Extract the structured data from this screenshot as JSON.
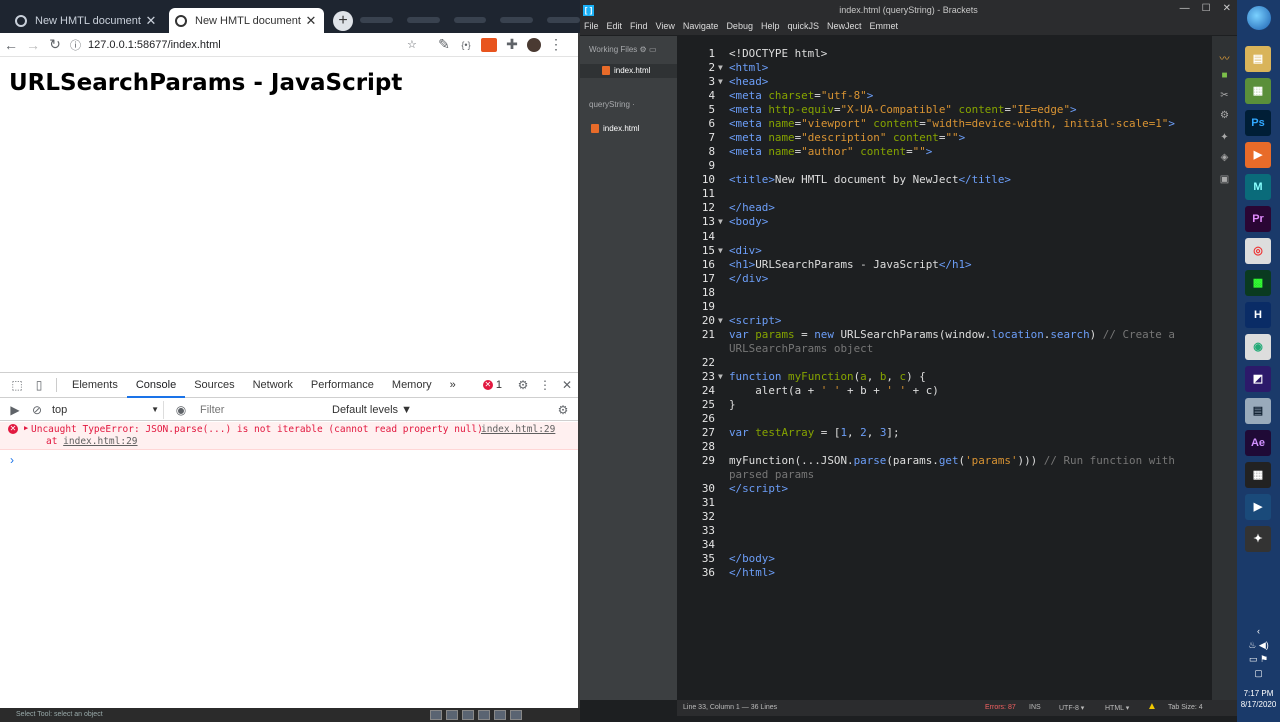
{
  "chrome": {
    "tabs": [
      {
        "title": "New HMTL document by NewJect",
        "close": "✕"
      },
      {
        "title": "New HMTL document by NewJect",
        "close": "✕"
      }
    ],
    "new_tab": "+",
    "toolbar": {
      "url": "127.0.0.1:58677/index.html"
    },
    "page": {
      "heading": "URLSearchParams - JavaScript"
    },
    "devtools": {
      "tabs": [
        "Elements",
        "Console",
        "Sources",
        "Network",
        "Performance",
        "Memory"
      ],
      "active_tab": "Console",
      "more": "»",
      "error_count": "1",
      "context": "top",
      "filter_placeholder": "Filter",
      "levels": "Default levels ▼",
      "error": {
        "message": "Uncaught TypeError: JSON.parse(...) is not iterable (cannot read property null)",
        "source": "index.html:29",
        "at_prefix": "at ",
        "at_link": "index.html:29"
      },
      "prompt": "›"
    },
    "statusbar": "Select Tool: select an object"
  },
  "brackets": {
    "title": "index.html (queryString) - Brackets",
    "menu": [
      "File",
      "Edit",
      "Find",
      "View",
      "Navigate",
      "Debug",
      "Help",
      "quickJS",
      "NewJect",
      "Emmet"
    ],
    "sidebar": {
      "working_files": "Working Files",
      "working_file": "index.html",
      "project": "queryString ·",
      "project_file": "index.html"
    },
    "status": {
      "position": "Line 33, Column 1 — 36 Lines",
      "errors": "Errors: 87",
      "ins": "INS",
      "encoding": "UTF-8 ▾",
      "language": "HTML ▾",
      "tab_size": "Tab Size:  4"
    },
    "gutter_numbers": [
      "1",
      "2",
      "3",
      "4",
      "5",
      "6",
      "7",
      "8",
      "9",
      "10",
      "11",
      "12",
      "13",
      "14",
      "15",
      "16",
      "17",
      "18",
      "19",
      "20",
      "21",
      "",
      "22",
      "23",
      "24",
      "25",
      "26",
      "27",
      "28",
      "29",
      "",
      "30",
      "31",
      "32",
      "33",
      "34",
      "35",
      "36"
    ],
    "fold_lines": [
      "2",
      "3",
      "13",
      "15",
      "20",
      "23"
    ]
  },
  "taskbar": {
    "apps": [
      {
        "name": "ps",
        "label": "Ps",
        "color": "#001e36"
      },
      {
        "name": "pr",
        "label": "Pr",
        "color": "#2a0634"
      },
      {
        "name": "ae",
        "label": "Ae",
        "color": "#1f0a36"
      },
      {
        "name": "h",
        "label": "H",
        "color": "#0a2c66"
      },
      {
        "name": "m",
        "label": "M",
        "color": "#0a6b7a"
      }
    ],
    "time": "7:17 PM",
    "date": "8/17/2020"
  }
}
